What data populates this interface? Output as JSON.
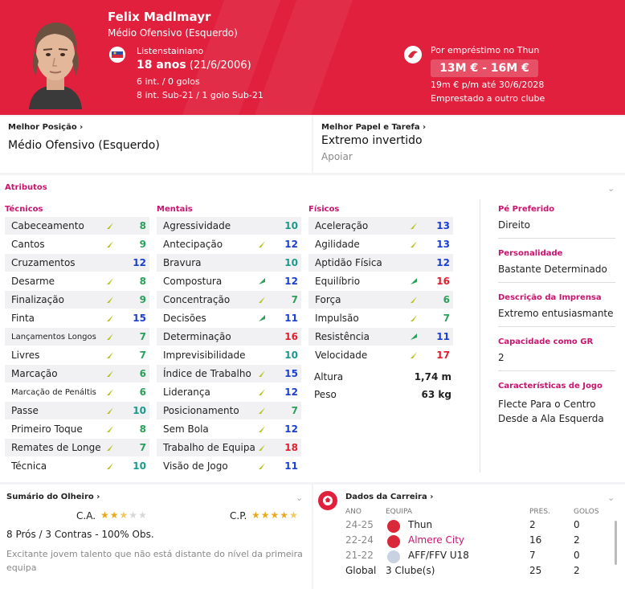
{
  "header": {
    "name": "Felix Madlmayr",
    "position": "Médio Ofensivo (Esquerdo)",
    "nationality": "Listenstainiano",
    "age": "18 anos",
    "dob": "(21/6/2006)",
    "caps": "6 int. / 0 golos",
    "youth_caps": "8 int. Sub-21 / 1 golo Sub-21",
    "loan_status": "Por empréstimo no Thun",
    "value": "13M € - 16M €",
    "wage": "19m € p/m até 30/6/2028",
    "loaned_out": "Emprestado a outro clube",
    "accent": "#e0203d"
  },
  "best_position": {
    "title": "Melhor Posição",
    "value": "Médio Ofensivo (Esquerdo)"
  },
  "best_role": {
    "title": "Melhor Papel e Tarefa",
    "value": "Extremo invertido",
    "duty": "Apoiar"
  },
  "attributes": {
    "title": "Atributos",
    "tecnicos": {
      "title": "Técnicos",
      "rows": [
        {
          "name": "Cabeceamento",
          "value": "8",
          "arrow": "down"
        },
        {
          "name": "Cantos",
          "value": "9",
          "arrow": "down"
        },
        {
          "name": "Cruzamentos",
          "value": "12",
          "arrow": ""
        },
        {
          "name": "Desarme",
          "value": "8",
          "arrow": "down"
        },
        {
          "name": "Finalização",
          "value": "9",
          "arrow": "down"
        },
        {
          "name": "Finta",
          "value": "15",
          "arrow": "down"
        },
        {
          "name": "Lançamentos Longos",
          "value": "7",
          "arrow": "down",
          "small": true
        },
        {
          "name": "Livres",
          "value": "7",
          "arrow": "down"
        },
        {
          "name": "Marcação",
          "value": "6",
          "arrow": "down"
        },
        {
          "name": "Marcação de Penáltis",
          "value": "6",
          "arrow": "down",
          "small": true
        },
        {
          "name": "Passe",
          "value": "10",
          "arrow": "down"
        },
        {
          "name": "Primeiro Toque",
          "value": "8",
          "arrow": "down"
        },
        {
          "name": "Remates de Longe",
          "value": "7",
          "arrow": "down"
        },
        {
          "name": "Técnica",
          "value": "10",
          "arrow": "down"
        }
      ]
    },
    "mentais": {
      "title": "Mentais",
      "rows": [
        {
          "name": "Agressividade",
          "value": "10",
          "arrow": ""
        },
        {
          "name": "Antecipação",
          "value": "12",
          "arrow": "down"
        },
        {
          "name": "Bravura",
          "value": "10",
          "arrow": ""
        },
        {
          "name": "Compostura",
          "value": "12",
          "arrow": "up"
        },
        {
          "name": "Concentração",
          "value": "7",
          "arrow": "down"
        },
        {
          "name": "Decisões",
          "value": "11",
          "arrow": "up"
        },
        {
          "name": "Determinação",
          "value": "16",
          "arrow": ""
        },
        {
          "name": "Imprevisibilidade",
          "value": "10",
          "arrow": ""
        },
        {
          "name": "Índice de Trabalho",
          "value": "15",
          "arrow": "down"
        },
        {
          "name": "Liderança",
          "value": "12",
          "arrow": "down"
        },
        {
          "name": "Posicionamento",
          "value": "7",
          "arrow": "down"
        },
        {
          "name": "Sem Bola",
          "value": "12",
          "arrow": "down"
        },
        {
          "name": "Trabalho de Equipa",
          "value": "18",
          "arrow": "down"
        },
        {
          "name": "Visão de Jogo",
          "value": "11",
          "arrow": "down"
        }
      ]
    },
    "fisicos": {
      "title": "Físicos",
      "rows": [
        {
          "name": "Aceleração",
          "value": "13",
          "arrow": "down"
        },
        {
          "name": "Agilidade",
          "value": "13",
          "arrow": "down"
        },
        {
          "name": "Aptidão Física",
          "value": "12",
          "arrow": ""
        },
        {
          "name": "Equilíbrio",
          "value": "16",
          "arrow": "up"
        },
        {
          "name": "Força",
          "value": "6",
          "arrow": "down"
        },
        {
          "name": "Impulsão",
          "value": "7",
          "arrow": "down"
        },
        {
          "name": "Resistência",
          "value": "11",
          "arrow": "up"
        },
        {
          "name": "Velocidade",
          "value": "17",
          "arrow": "down"
        }
      ],
      "height_label": "Altura",
      "height": "1,74 m",
      "weight_label": "Peso",
      "weight": "63 kg"
    }
  },
  "side": {
    "foot_title": "Pé Preferido",
    "foot": "Direito",
    "personality_title": "Personalidade",
    "personality": "Bastante Determinado",
    "press_title": "Descrição da Imprensa",
    "press": "Extremo entusiasmante",
    "gk_title": "Capacidade como GR",
    "gk": "2",
    "traits_title": "Características de Jogo",
    "traits": [
      "Flecte Para o Centro",
      "Desde a Ala Esquerda"
    ]
  },
  "scout": {
    "title": "Sumário do Olheiro",
    "ca_label": "C.A.",
    "pa_label": "C.P.",
    "ca_stars": 2.5,
    "pa_stars": 4.5,
    "summary": "8 Prós / 3 Contras - 100% Obs.",
    "comment": "Excitante jovem talento que não está distante do nível da primeira equipa"
  },
  "career": {
    "title": "Dados da Carreira",
    "headers": {
      "year": "ANO",
      "team": "EQUIPA",
      "apps": "PRES.",
      "goals": "GOLOS"
    },
    "rows": [
      {
        "year": "24-25",
        "team": "Thun",
        "apps": "2",
        "goals": "0",
        "color": "#222"
      },
      {
        "year": "22-24",
        "team": "Almere City",
        "apps": "16",
        "goals": "2",
        "color": "#c8146e"
      },
      {
        "year": "21-22",
        "team": "AFF/FFV U18",
        "apps": "7",
        "goals": "0",
        "color": "#222"
      }
    ],
    "total": {
      "year": "Global",
      "team": "3 Clube(s)",
      "apps": "25",
      "goals": "2"
    }
  },
  "colors": {
    "green": "#2aa05a",
    "teal": "#1a9a8a",
    "blue": "#1b3fd0",
    "red": "#e01e2e",
    "pink": "#c8146e"
  }
}
